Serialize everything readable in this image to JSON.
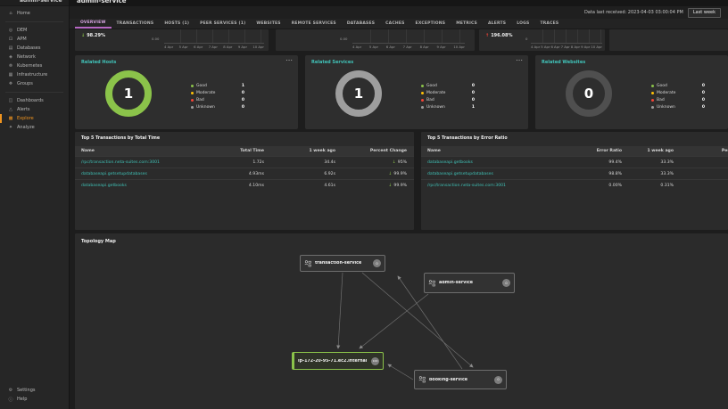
{
  "header": {
    "page_title": "admin-service",
    "data_last_received": "Data last received: 2023-04-03 03:00:04 PM",
    "time_range": "Last week"
  },
  "sidebar": {
    "items": [
      {
        "label": "Home",
        "icon": "home-icon"
      },
      {
        "label": "DEM",
        "icon": "dem-icon"
      },
      {
        "label": "APM",
        "icon": "apm-icon"
      },
      {
        "label": "Databases",
        "icon": "databases-icon"
      },
      {
        "label": "Network",
        "icon": "network-icon"
      },
      {
        "label": "Kubernetes",
        "icon": "kubernetes-icon"
      },
      {
        "label": "Infrastructure",
        "icon": "infrastructure-icon"
      },
      {
        "label": "Groups",
        "icon": "groups-icon"
      },
      {
        "label": "Dashboards",
        "icon": "dashboards-icon"
      },
      {
        "label": "Alerts",
        "icon": "alerts-icon"
      },
      {
        "label": "Explore",
        "icon": "explore-icon"
      },
      {
        "label": "Analyze",
        "icon": "analyze-icon"
      }
    ],
    "active_item": "Explore",
    "bottom_items": [
      {
        "label": "Settings",
        "icon": "settings-icon"
      },
      {
        "label": "Help",
        "icon": "help-icon"
      }
    ]
  },
  "tabs": {
    "active": "OVERVIEW",
    "labels": [
      "OVERVIEW",
      "TRANSACTIONS",
      "HOSTS (1)",
      "PEER SERVICES (1)",
      "WEBSITES",
      "REMOTE SERVICES",
      "DATABASES",
      "CACHES",
      "EXCEPTIONS",
      "METRICS",
      "ALERTS",
      "LOGS",
      "TRACES"
    ]
  },
  "metric_cards": [
    {
      "change": "98.29%",
      "arrow": "↓",
      "direction": "down",
      "axis_zero": "0.00",
      "dates": [
        "4 Apr",
        "5 Apr",
        "6 Apr",
        "7 Apr",
        "8 Apr",
        "9 Apr",
        "10 Apr"
      ]
    },
    {
      "axis_zero": "0.00",
      "dates": [
        "4 Apr",
        "5 Apr",
        "6 Apr",
        "7 Apr",
        "8 Apr",
        "9 Apr",
        "10 Apr"
      ]
    },
    {
      "change": "196.08%",
      "arrow": "↑",
      "direction": "up",
      "axis_zero": "0",
      "dates": [
        "4 Apr",
        "5 Apr",
        "6 Apr",
        "7 Apr",
        "8 Apr",
        "9 Apr",
        "10 Apr"
      ]
    }
  ],
  "related_cards": [
    {
      "title": "Related Hosts",
      "center_value": "1",
      "ring_color": "#8bc34a",
      "legend": [
        {
          "label": "Good",
          "value": "1",
          "color": "#8bc34a"
        },
        {
          "label": "Moderate",
          "value": "0",
          "color": "#ffc107"
        },
        {
          "label": "Bad",
          "value": "0",
          "color": "#f44336"
        },
        {
          "label": "Unknown",
          "value": "0",
          "color": "#9e9e9e"
        }
      ]
    },
    {
      "title": "Related Services",
      "center_value": "1",
      "ring_color": "#9e9e9e",
      "legend": [
        {
          "label": "Good",
          "value": "0",
          "color": "#8bc34a"
        },
        {
          "label": "Moderate",
          "value": "0",
          "color": "#ffc107"
        },
        {
          "label": "Bad",
          "value": "0",
          "color": "#f44336"
        },
        {
          "label": "Unknown",
          "value": "1",
          "color": "#9e9e9e"
        }
      ]
    },
    {
      "title": "Related Websites",
      "center_value": "0",
      "ring_color": "#4f4f4f",
      "legend": [
        {
          "label": "Good",
          "value": "0",
          "color": "#8bc34a"
        },
        {
          "label": "Moderate",
          "value": "0",
          "color": "#ffc107"
        },
        {
          "label": "Bad",
          "value": "0",
          "color": "#f44336"
        },
        {
          "label": "Unknown",
          "value": "0",
          "color": "#9e9e9e"
        }
      ]
    }
  ],
  "tables": [
    {
      "title": "Top 5 Transactions by Total Time",
      "headers": [
        "Name",
        "Total Time",
        "1 week ago",
        "Percent Change"
      ],
      "rows": [
        {
          "name": "/rpc/transaction.neta-suites.com:3001",
          "col2": "1.72s",
          "col3": "34.4s",
          "change": "95%",
          "change_arrow": "↓"
        },
        {
          "name": "databaseapi.getsetupdatabases",
          "col2": "4.93ms",
          "col3": "6.92s",
          "change": "99.9%",
          "change_arrow": "↓"
        },
        {
          "name": "databaseapi.getbooks",
          "col2": "4.10ms",
          "col3": "4.61s",
          "change": "99.9%",
          "change_arrow": "↓"
        }
      ]
    },
    {
      "title": "Top 5 Transactions by Error Ratio",
      "headers": [
        "Name",
        "Error Ratio",
        "1 week ago",
        "Percent Change"
      ],
      "rows": [
        {
          "name": "databaseapi.getbooks",
          "col2": "99.4%",
          "col3": "33.3%",
          "change": "",
          "change_arrow": ""
        },
        {
          "name": "databaseapi.getsetupdatabases",
          "col2": "98.8%",
          "col3": "33.3%",
          "change": "",
          "change_arrow": ""
        },
        {
          "name": "/rpc/transaction.neta-suites.com:3001",
          "col2": "0.00%",
          "col3": "0.31%",
          "change": "",
          "change_arrow": ""
        }
      ]
    }
  ],
  "topology": {
    "title": "Topology Map",
    "nodes": [
      {
        "label": "transaction-service",
        "badge": "0",
        "type": "service"
      },
      {
        "label": "admin-service",
        "badge": "0",
        "type": "service"
      },
      {
        "label": "ip-172-20-95-71.ec2.internal",
        "badge": "100",
        "type": "host"
      },
      {
        "label": "booking-service",
        "badge": "0",
        "type": "service"
      }
    ]
  },
  "colors": {
    "accent_teal": "#41c3b9",
    "accent_orange": "#f0941f",
    "tab_active": "#b768c4",
    "good": "#8bc34a",
    "moderate": "#ffc107",
    "bad": "#f44336",
    "unknown": "#9e9e9e",
    "up_red": "#f44336",
    "down_green": "#8bc34a"
  }
}
